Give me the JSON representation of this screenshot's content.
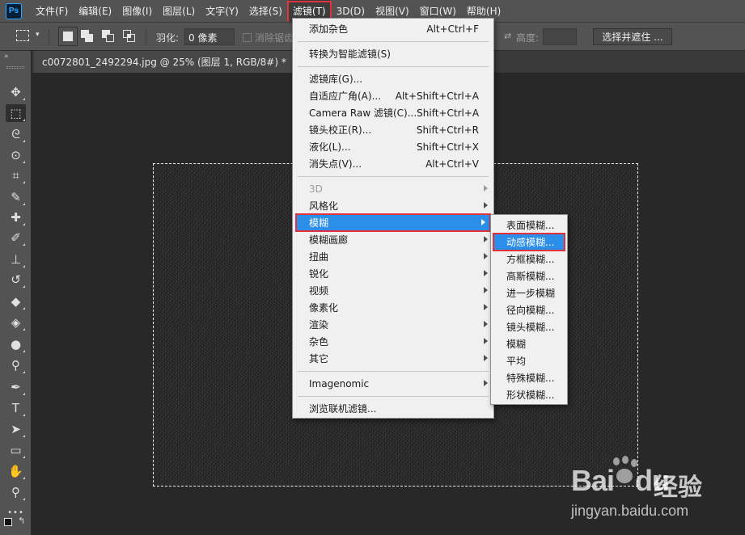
{
  "app": {
    "logo": "Ps"
  },
  "menubar": [
    {
      "label": "文件(F)",
      "active": false
    },
    {
      "label": "编辑(E)",
      "active": false
    },
    {
      "label": "图像(I)",
      "active": false
    },
    {
      "label": "图层(L)",
      "active": false
    },
    {
      "label": "文字(Y)",
      "active": false
    },
    {
      "label": "选择(S)",
      "active": false
    },
    {
      "label": "滤镜(T)",
      "active": true
    },
    {
      "label": "3D(D)",
      "active": false
    },
    {
      "label": "视图(V)",
      "active": false
    },
    {
      "label": "窗口(W)",
      "active": false
    },
    {
      "label": "帮助(H)",
      "active": false
    }
  ],
  "options": {
    "feather_label": "羽化:",
    "feather_value": "0 像素",
    "antialias_label": "消除锯齿",
    "height_label": "高度:",
    "select_mask_label": "选择并遮住 ..."
  },
  "toolbar": {
    "collapse": "»",
    "tools": [
      {
        "name": "move-tool",
        "glyph": "✥",
        "active": false
      },
      {
        "name": "marquee-tool",
        "glyph": "⬚",
        "active": true
      },
      {
        "name": "lasso-tool",
        "glyph": "ᘓ",
        "active": false
      },
      {
        "name": "quick-select-tool",
        "glyph": "⊙",
        "active": false
      },
      {
        "name": "crop-tool",
        "glyph": "⌗",
        "active": false
      },
      {
        "name": "eyedropper-tool",
        "glyph": "✎",
        "active": false
      },
      {
        "name": "healing-brush-tool",
        "glyph": "✚",
        "active": false
      },
      {
        "name": "brush-tool",
        "glyph": "✐",
        "active": false
      },
      {
        "name": "clone-stamp-tool",
        "glyph": "⊥",
        "active": false
      },
      {
        "name": "history-brush-tool",
        "glyph": "↺",
        "active": false
      },
      {
        "name": "eraser-tool",
        "glyph": "◆",
        "active": false
      },
      {
        "name": "paint-bucket-tool",
        "glyph": "◈",
        "active": false
      },
      {
        "name": "blur-tool",
        "glyph": "●",
        "active": false
      },
      {
        "name": "dodge-tool",
        "glyph": "⚲",
        "active": false
      },
      {
        "name": "pen-tool",
        "glyph": "✒",
        "active": false
      },
      {
        "name": "type-tool",
        "glyph": "T",
        "active": false
      },
      {
        "name": "path-select-tool",
        "glyph": "➤",
        "active": false
      },
      {
        "name": "rectangle-tool",
        "glyph": "▭",
        "active": false
      },
      {
        "name": "hand-tool",
        "glyph": "✋",
        "active": false
      },
      {
        "name": "zoom-tool",
        "glyph": "⚲",
        "active": false
      },
      {
        "name": "more-tools",
        "glyph": "•••",
        "active": false
      }
    ]
  },
  "document": {
    "tab_title": "c0072801_2492294.jpg @ 25% (图层 1, RGB/8#) *"
  },
  "filter_menu": {
    "items": [
      {
        "label": "添加杂色",
        "shortcut": "Alt+Ctrl+F"
      },
      {
        "sep": true
      },
      {
        "label": "转换为智能滤镜(S)"
      },
      {
        "sep": true
      },
      {
        "label": "滤镜库(G)..."
      },
      {
        "label": "自适应广角(A)...",
        "shortcut": "Alt+Shift+Ctrl+A"
      },
      {
        "label": "Camera Raw 滤镜(C)...",
        "shortcut": "Shift+Ctrl+A"
      },
      {
        "label": "镜头校正(R)...",
        "shortcut": "Shift+Ctrl+R"
      },
      {
        "label": "液化(L)...",
        "shortcut": "Shift+Ctrl+X"
      },
      {
        "label": "消失点(V)...",
        "shortcut": "Alt+Ctrl+V"
      },
      {
        "sep": true
      },
      {
        "label": "3D",
        "submenu": true,
        "disabled": true
      },
      {
        "label": "风格化",
        "submenu": true
      },
      {
        "label": "模糊",
        "submenu": true,
        "highlight": true
      },
      {
        "label": "模糊画廊",
        "submenu": true
      },
      {
        "label": "扭曲",
        "submenu": true
      },
      {
        "label": "锐化",
        "submenu": true
      },
      {
        "label": "视频",
        "submenu": true
      },
      {
        "label": "像素化",
        "submenu": true
      },
      {
        "label": "渲染",
        "submenu": true
      },
      {
        "label": "杂色",
        "submenu": true
      },
      {
        "label": "其它",
        "submenu": true
      },
      {
        "sep": true
      },
      {
        "label": "Imagenomic",
        "submenu": true
      },
      {
        "sep": true
      },
      {
        "label": "浏览联机滤镜..."
      }
    ]
  },
  "blur_submenu": {
    "items": [
      {
        "label": "表面模糊..."
      },
      {
        "label": "动感模糊...",
        "highlight": true
      },
      {
        "label": "方框模糊..."
      },
      {
        "label": "高斯模糊..."
      },
      {
        "label": "进一步模糊"
      },
      {
        "label": "径向模糊..."
      },
      {
        "label": "镜头模糊..."
      },
      {
        "label": "模糊"
      },
      {
        "label": "平均"
      },
      {
        "label": "特殊模糊..."
      },
      {
        "label": "形状模糊..."
      }
    ]
  },
  "watermark": {
    "brand": "Bai",
    "brand2": "du",
    "cn": "经验",
    "url": "jingyan.baidu.com"
  },
  "colors": {
    "highlight": "#2b8ee9",
    "annotation_red": "#e0313c",
    "menu_bg": "#f0f0f0",
    "chrome": "#535353"
  }
}
